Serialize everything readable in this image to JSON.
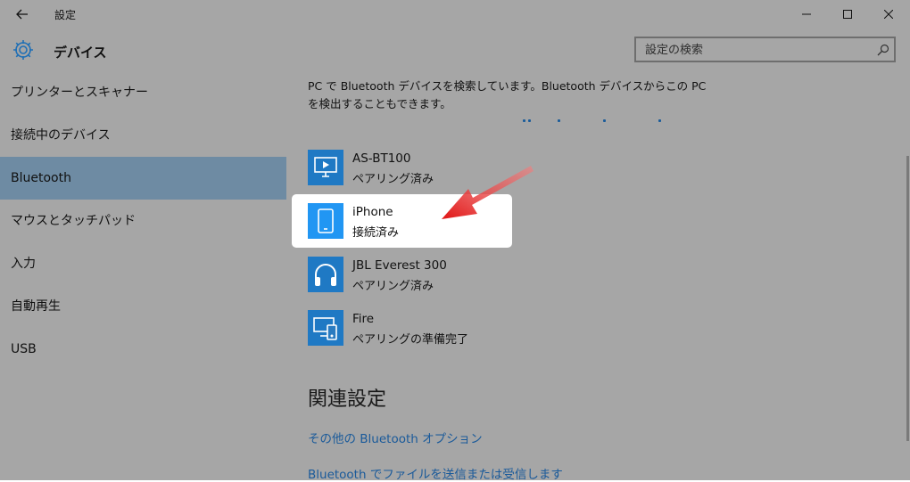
{
  "window": {
    "title": "設定"
  },
  "header": {
    "title": "デバイス",
    "search_placeholder": "設定の検索"
  },
  "sidebar": {
    "items": [
      {
        "label": "プリンターとスキャナー",
        "selected": false
      },
      {
        "label": "接続中のデバイス",
        "selected": false
      },
      {
        "label": "Bluetooth",
        "selected": true
      },
      {
        "label": "マウスとタッチパッド",
        "selected": false
      },
      {
        "label": "入力",
        "selected": false
      },
      {
        "label": "自動再生",
        "selected": false
      },
      {
        "label": "USB",
        "selected": false
      }
    ]
  },
  "main": {
    "description": "PC で Bluetooth デバイスを検索しています。Bluetooth デバイスからこの PC を検出することもできます。",
    "devices": [
      {
        "name": "AS-BT100",
        "status": "ペアリング済み",
        "icon": "media-display-icon"
      },
      {
        "name": "iPhone",
        "status": "接続済み",
        "icon": "phone-icon"
      },
      {
        "name": "JBL Everest 300",
        "status": "ペアリング済み",
        "icon": "headphones-icon"
      },
      {
        "name": "Fire",
        "status": "ペアリングの準備完了",
        "icon": "devices-icon"
      }
    ],
    "related_title": "関連設定",
    "links": [
      "その他の Bluetooth オプション",
      "Bluetooth でファイルを送信または受信します"
    ]
  },
  "colors": {
    "accent": "#1f79c4",
    "background": "#a6a6a6",
    "selected": "#6e8ba3",
    "link": "#1a5a9a",
    "arrow": "#e21b1b"
  }
}
